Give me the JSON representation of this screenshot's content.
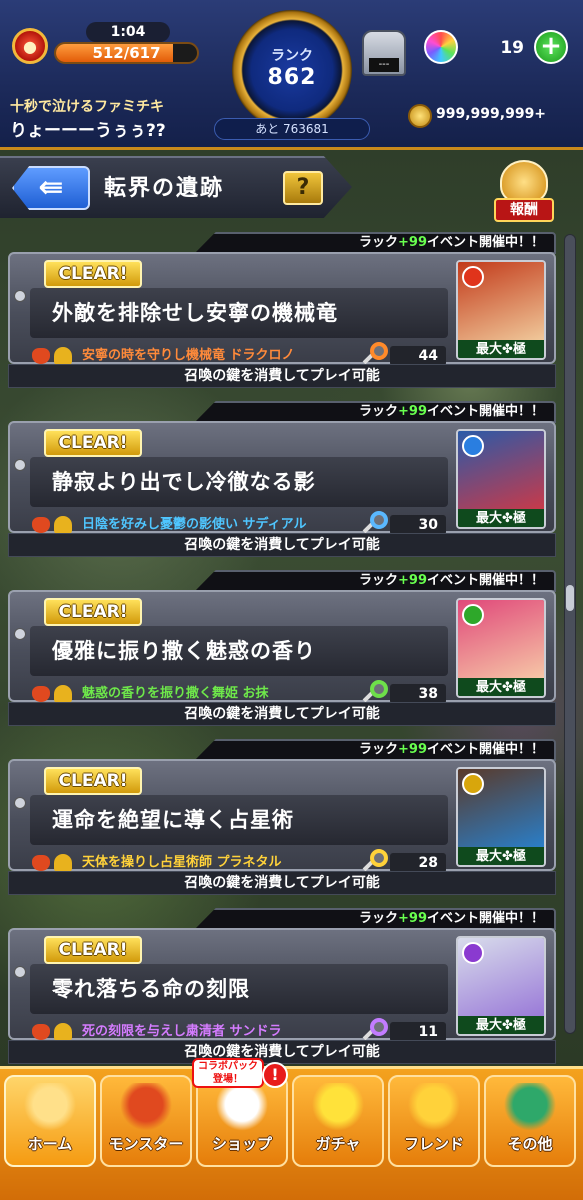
{
  "status": {
    "stamina_timer": "1:04",
    "stamina_current": "512/617",
    "stamina_fraction": 0.83,
    "rank_label": "ランク",
    "rank_value": "862",
    "rank_next": "あと 763681",
    "gacha_screen": "---",
    "orb_count": "19",
    "orb_plus": "+",
    "player_subtitle": "十秒で泣けるファミチキ",
    "player_name": "りょーーーうぅぅ??",
    "coins": "999,999,999+"
  },
  "header": {
    "title": "転界の遺跡",
    "help": "?",
    "reward": "報酬",
    "back_arrow": "⇚"
  },
  "quests": [
    {
      "clear": "CLEAR!",
      "event_prefix": "ラック",
      "event_plus": "+99",
      "event_suffix": "イベント開催中！！",
      "title": "外敵を排除せし安寧の機械竜",
      "boss": "安寧の時を守りし機械竜 ドラクロノ",
      "boss_color": "#ff8a3a",
      "key_color": "#ff8a2a",
      "key_count": "44",
      "max_label": "最大✤極",
      "element_color": "#e0341b",
      "art_colors": [
        "#c23a1a",
        "#f0c89a"
      ],
      "summon": "召喚の鍵を消費してプレイ可能"
    },
    {
      "clear": "CLEAR!",
      "event_prefix": "ラック",
      "event_plus": "+99",
      "event_suffix": "イベント開催中！！",
      "title": "静寂より出でし冷徹なる影",
      "boss": "日陰を好みし憂鬱の影使い サディアル",
      "boss_color": "#4fc6ff",
      "key_color": "#5ab8ff",
      "key_count": "30",
      "max_label": "最大✤極",
      "element_color": "#2a7ee0",
      "art_colors": [
        "#2a5aa8",
        "#c83a4a"
      ],
      "summon": "召喚の鍵を消費してプレイ可能"
    },
    {
      "clear": "CLEAR!",
      "event_prefix": "ラック",
      "event_plus": "+99",
      "event_suffix": "イベント開催中！！",
      "title": "優雅に振り撒く魅惑の香り",
      "boss": "魅惑の香りを振り撒く舞姫 お抹",
      "boss_color": "#6ee84a",
      "key_color": "#6ee04a",
      "key_count": "38",
      "max_label": "最大✤極",
      "element_color": "#2ea82a",
      "art_colors": [
        "#e0487a",
        "#f6c6a6"
      ],
      "summon": "召喚の鍵を消費してプレイ可能"
    },
    {
      "clear": "CLEAR!",
      "event_prefix": "ラック",
      "event_plus": "+99",
      "event_suffix": "イベント開催中！！",
      "title": "運命を絶望に導く占星術",
      "boss": "天体を操りし占星術師 プラネタル",
      "boss_color": "#ffd23a",
      "key_color": "#ffd23a",
      "key_count": "28",
      "max_label": "最大✤極",
      "element_color": "#d8a60c",
      "art_colors": [
        "#5a3a2a",
        "#2a7ec8"
      ],
      "summon": "召喚の鍵を消費してプレイ可能"
    },
    {
      "clear": "CLEAR!",
      "event_prefix": "ラック",
      "event_plus": "+99",
      "event_suffix": "イベント開催中！！",
      "title": "零れ落ちる命の刻限",
      "boss": "死の刻限を与えし粛清者 サンドラ",
      "boss_color": "#d57cff",
      "key_color": "#c27cff",
      "key_count": "11",
      "max_label": "最大✤極",
      "element_color": "#8a3ad0",
      "art_colors": [
        "#d8dceb",
        "#9a7ad8"
      ],
      "summon": "召喚の鍵を消費してプレイ可能"
    }
  ],
  "nav": {
    "collab_line1": "コラボパック",
    "collab_line2": "登場！",
    "alert": "!",
    "items": [
      {
        "label": "ホーム",
        "icon": "home-icon",
        "color": "#ffe08a"
      },
      {
        "label": "モンスター",
        "icon": "monster-icon",
        "color": "#e0491f"
      },
      {
        "label": "ショップ",
        "icon": "shop-icon",
        "color": "#ffffff"
      },
      {
        "label": "ガチャ",
        "icon": "gacha-icon",
        "color": "#ffe23a"
      },
      {
        "label": "フレンド",
        "icon": "friend-icon",
        "color": "#ffd23a"
      },
      {
        "label": "その他",
        "icon": "other-icon",
        "color": "#2ea86a"
      }
    ]
  }
}
